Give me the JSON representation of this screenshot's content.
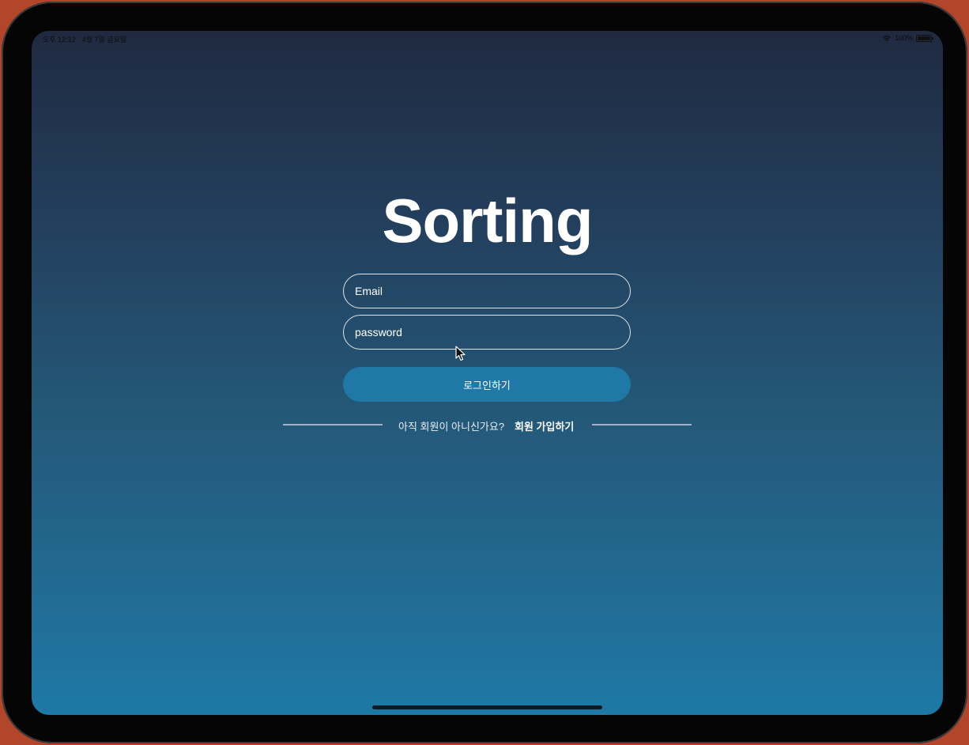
{
  "status_bar": {
    "time": "오후 12:12",
    "date": "4월 7일 금요일",
    "battery": "100%",
    "battery_level": 1.0,
    "wifi_icon": "wifi-icon",
    "battery_icon": "battery-icon"
  },
  "login": {
    "title": "Sorting",
    "email_placeholder": "Email",
    "password_placeholder": "password",
    "login_button": "로그인하기",
    "signup_prompt": "아직 회원이 아니신가요?",
    "signup_link": "회원 가입하기"
  },
  "colors": {
    "background_top": "#1f2a40",
    "background_bottom": "#1e79a6",
    "button": "#1f78a6",
    "text": "#ffffff"
  }
}
